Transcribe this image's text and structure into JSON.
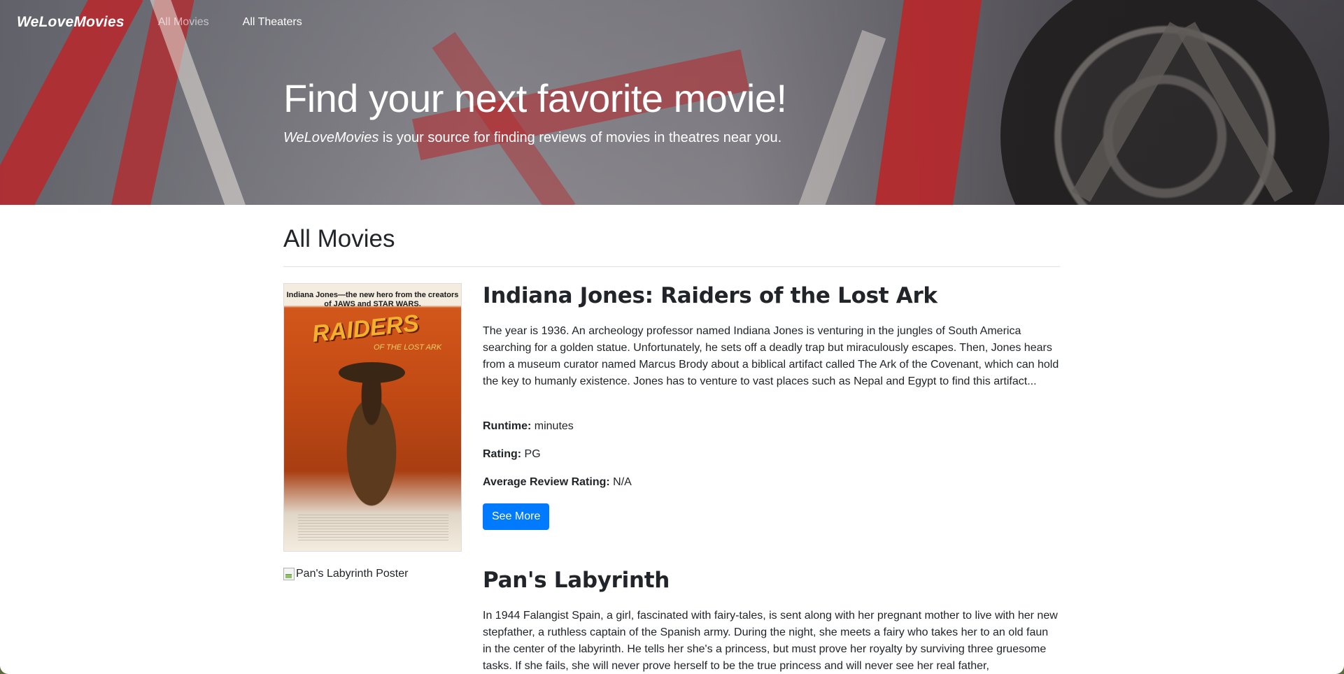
{
  "navbar": {
    "brand": "WeLoveMovies",
    "links": [
      {
        "label": "All Movies",
        "active": false
      },
      {
        "label": "All Theaters",
        "active": true
      }
    ]
  },
  "hero": {
    "title": "Find your next favorite movie!",
    "subtitle_brand": "WeLoveMovies",
    "subtitle_rest": " is your source for finding reviews of movies in theatres near you."
  },
  "main": {
    "section_title": "All Movies",
    "movies": [
      {
        "title": "Indiana Jones: Raiders of the Lost Ark",
        "poster_alt": "Raiders of the Lost Ark Poster",
        "poster_tagline": "Indiana Jones—the new hero from the creators of JAWS and STAR WARS.",
        "poster_logo": "RAIDERS",
        "poster_logo_sub": "OF THE LOST ARK",
        "description": "The year is 1936. An archeology professor named Indiana Jones is venturing in the jungles of South America searching for a golden statue. Unfortunately, he sets off a deadly trap but miraculously escapes. Then, Jones hears from a museum curator named Marcus Brody about a biblical artifact called The Ark of the Covenant, which can hold the key to humanly existence. Jones has to venture to vast places such as Nepal and Egypt to find this artifact...",
        "runtime_label": "Runtime:",
        "runtime_value": " minutes",
        "rating_label": "Rating:",
        "rating_value": " PG",
        "avg_label": "Average Review Rating:",
        "avg_value": " N/A",
        "button_label": "See More"
      },
      {
        "title": "Pan's Labyrinth",
        "poster_alt": "Pan's Labyrinth Poster",
        "description": "In 1944 Falangist Spain, a girl, fascinated with fairy-tales, is sent along with her pregnant mother to live with her new stepfather, a ruthless captain of the Spanish army. During the night, she meets a fairy who takes her to an old faun in the center of the labyrinth. He tells her she's a princess, but must prove her royalty by surviving three gruesome tasks. If she fails, she will never prove herself to be the true princess and will never see her real father,"
      }
    ]
  },
  "colors": {
    "primary_button": "#007bff",
    "text": "#212529",
    "divider": "#dee2e6"
  }
}
